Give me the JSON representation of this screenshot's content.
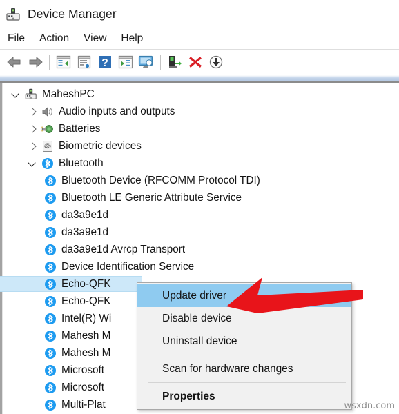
{
  "window": {
    "title": "Device Manager",
    "icon": "device-manager-icon"
  },
  "menubar": {
    "items": [
      {
        "label": "File"
      },
      {
        "label": "Action"
      },
      {
        "label": "View"
      },
      {
        "label": "Help"
      }
    ]
  },
  "toolbar": {
    "buttons": [
      {
        "name": "back-button",
        "icon": "back-arrow-icon"
      },
      {
        "name": "forward-button",
        "icon": "forward-arrow-icon"
      },
      {
        "name": "separator-1",
        "icon": "separator"
      },
      {
        "name": "show-hide-console-tree-button",
        "icon": "console-tree-icon"
      },
      {
        "name": "properties-button",
        "icon": "properties-window-icon"
      },
      {
        "name": "help-button",
        "icon": "help-question-icon"
      },
      {
        "name": "show-hide-action-pane-button",
        "icon": "action-pane-icon"
      },
      {
        "name": "display-resources-button",
        "icon": "monitor-icon"
      },
      {
        "name": "separator-2",
        "icon": "separator"
      },
      {
        "name": "update-driver-button",
        "icon": "update-driver-icon"
      },
      {
        "name": "uninstall-device-button",
        "icon": "red-x-icon"
      },
      {
        "name": "scan-hardware-changes-button",
        "icon": "scan-download-icon"
      }
    ]
  },
  "tree": {
    "root": {
      "label": "MaheshPC",
      "icon": "computer-icon",
      "expanded": true
    },
    "categories": [
      {
        "label": "Audio inputs and outputs",
        "icon": "speaker-icon",
        "expanded": false
      },
      {
        "label": "Batteries",
        "icon": "battery-icon",
        "expanded": false
      },
      {
        "label": "Biometric devices",
        "icon": "fingerprint-icon",
        "expanded": false
      },
      {
        "label": "Bluetooth",
        "icon": "bluetooth-icon",
        "expanded": true
      }
    ],
    "bluetooth_devices": [
      {
        "label": "Bluetooth Device (RFCOMM Protocol TDI)",
        "icon": "bluetooth-icon",
        "selected": false
      },
      {
        "label": "Bluetooth LE Generic Attribute Service",
        "icon": "bluetooth-icon",
        "selected": false
      },
      {
        "label": "da3a9e1d",
        "icon": "bluetooth-icon",
        "selected": false
      },
      {
        "label": "da3a9e1d",
        "icon": "bluetooth-icon",
        "selected": false
      },
      {
        "label": "da3a9e1d Avrcp Transport",
        "icon": "bluetooth-icon",
        "selected": false
      },
      {
        "label": "Device Identification Service",
        "icon": "bluetooth-icon",
        "selected": false
      },
      {
        "label": "Echo-QFK",
        "icon": "bluetooth-icon",
        "selected": true
      },
      {
        "label": "Echo-QFK",
        "icon": "bluetooth-icon",
        "selected": false
      },
      {
        "label": "Intel(R) Wi",
        "icon": "bluetooth-icon",
        "selected": false
      },
      {
        "label": "Mahesh M",
        "icon": "bluetooth-icon",
        "selected": false
      },
      {
        "label": "Mahesh M",
        "icon": "bluetooth-icon",
        "selected": false
      },
      {
        "label": "Microsoft",
        "icon": "bluetooth-icon",
        "selected": false
      },
      {
        "label": "Microsoft",
        "icon": "bluetooth-icon",
        "selected": false
      },
      {
        "label": "Multi-Plat",
        "icon": "bluetooth-icon",
        "selected": false
      }
    ]
  },
  "context_menu": {
    "items": [
      {
        "label": "Update driver",
        "highlighted": true,
        "bold": false
      },
      {
        "label": "Disable device",
        "highlighted": false,
        "bold": false
      },
      {
        "label": "Uninstall device",
        "highlighted": false,
        "bold": false
      },
      {
        "separator": true
      },
      {
        "label": "Scan for hardware changes",
        "highlighted": false,
        "bold": false
      },
      {
        "separator": true
      },
      {
        "label": "Properties",
        "highlighted": false,
        "bold": true
      }
    ]
  },
  "annotation": {
    "arrow": "red-left-arrow",
    "color": "#e8141a"
  },
  "watermark": {
    "text": "wsxdn.com"
  },
  "colors": {
    "selection_blue": "#cde8f9",
    "menu_highlight": "#8fcbf0",
    "bluetooth_blue": "#1d9bf0",
    "annotation_red": "#e8141a"
  }
}
